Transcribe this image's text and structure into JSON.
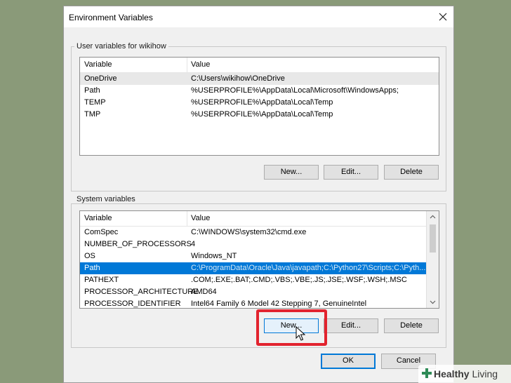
{
  "dialog": {
    "title": "Environment Variables"
  },
  "user_vars": {
    "group_label": "User variables for wikihow",
    "columns": [
      "Variable",
      "Value"
    ],
    "rows": [
      {
        "name": "OneDrive",
        "value": "C:\\Users\\wikihow\\OneDrive"
      },
      {
        "name": "Path",
        "value": "%USERPROFILE%\\AppData\\Local\\Microsoft\\WindowsApps;"
      },
      {
        "name": "TEMP",
        "value": "%USERPROFILE%\\AppData\\Local\\Temp"
      },
      {
        "name": "TMP",
        "value": "%USERPROFILE%\\AppData\\Local\\Temp"
      }
    ],
    "buttons": {
      "new": "New...",
      "edit": "Edit...",
      "delete": "Delete"
    }
  },
  "system_vars": {
    "group_label": "System variables",
    "columns": [
      "Variable",
      "Value"
    ],
    "rows": [
      {
        "name": "ComSpec",
        "value": "C:\\WINDOWS\\system32\\cmd.exe"
      },
      {
        "name": "NUMBER_OF_PROCESSORS",
        "value": "4"
      },
      {
        "name": "OS",
        "value": "Windows_NT"
      },
      {
        "name": "Path",
        "value": "C:\\ProgramData\\Oracle\\Java\\javapath;C:\\Python27\\Scripts;C:\\Pyth..."
      },
      {
        "name": "PATHEXT",
        "value": ".COM;.EXE;.BAT;.CMD;.VBS;.VBE;.JS;.JSE;.WSF;.WSH;.MSC"
      },
      {
        "name": "PROCESSOR_ARCHITECTURE",
        "value": "AMD64"
      },
      {
        "name": "PROCESSOR_IDENTIFIER",
        "value": "Intel64 Family 6 Model 42 Stepping 7, GenuineIntel"
      }
    ],
    "selected_row": "Path",
    "buttons": {
      "new": "New...",
      "edit": "Edit...",
      "delete": "Delete"
    }
  },
  "footer": {
    "ok": "OK",
    "cancel": "Cancel"
  },
  "watermark": {
    "brand_bold": "Healthy",
    "brand_light": " Living"
  },
  "colors": {
    "accent": "#0078d7",
    "highlight": "#e2232e",
    "background": "#8a9a79"
  },
  "icons": [
    "close-icon",
    "scroll-up-icon",
    "scroll-down-icon",
    "mouse-cursor-icon",
    "plus-icon"
  ]
}
